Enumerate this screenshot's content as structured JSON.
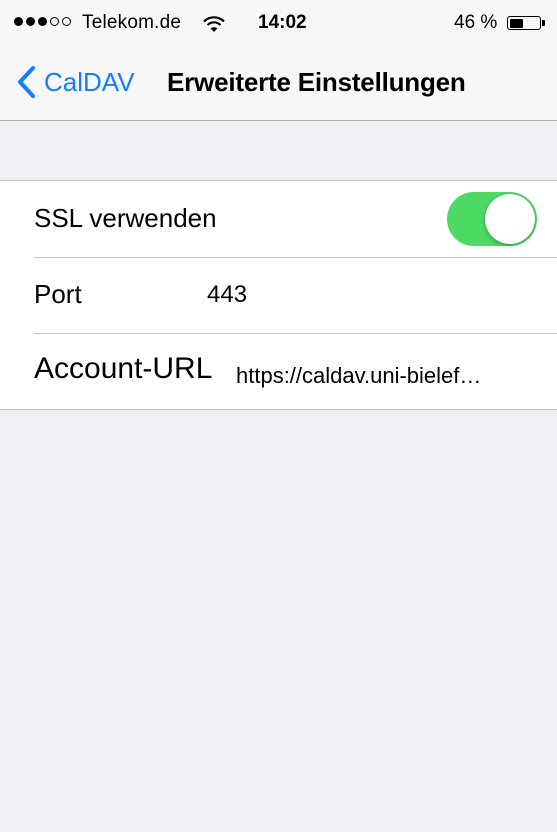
{
  "status_bar": {
    "signal_strength": "3 of 5",
    "carrier": "Telekom.de",
    "wifi_icon": "wifi-icon",
    "time": "14:02",
    "battery_percent": "46 %",
    "battery_level": 0.46
  },
  "nav_bar": {
    "back_label": "CalDAV",
    "back_icon": "chevron-left-icon",
    "title": "Erweiterte Einstellungen"
  },
  "settings": {
    "ssl": {
      "label": "SSL verwenden",
      "enabled": true
    },
    "port": {
      "label": "Port",
      "value": "443"
    },
    "account_url": {
      "label": "Account-URL",
      "value": "https://caldav.uni-bielef…"
    }
  },
  "colors": {
    "accent": "#157efb",
    "toggle_on": "#4cd964",
    "background": "#efeff4",
    "separator": "#c8c7cc"
  }
}
